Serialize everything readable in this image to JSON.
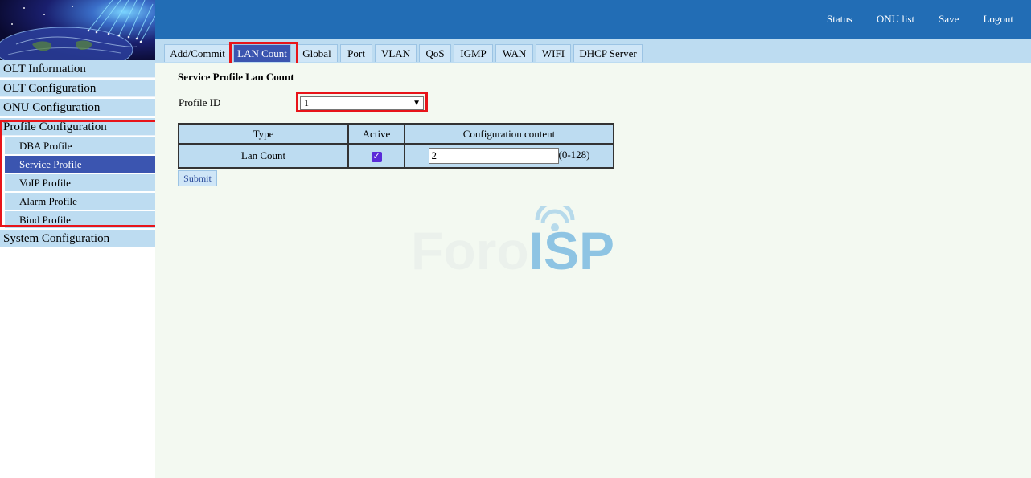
{
  "header": {
    "links": [
      "Status",
      "ONU list",
      "Save",
      "Logout"
    ]
  },
  "tabs": [
    "Add/Commit",
    "LAN Count",
    "Global",
    "Port",
    "VLAN",
    "QoS",
    "IGMP",
    "WAN",
    "WIFI",
    "DHCP Server"
  ],
  "active_tab": "LAN Count",
  "sidebar": {
    "items": [
      "OLT Information",
      "OLT Configuration",
      "ONU Configuration",
      "Profile Configuration"
    ],
    "sub_items": [
      "DBA Profile",
      "Service Profile",
      "VoIP Profile",
      "Alarm Profile",
      "Bind Profile"
    ],
    "active_sub": "Service Profile",
    "last_item": "System Configuration"
  },
  "main": {
    "title": "Service Profile Lan Count",
    "profile_label": "Profile ID",
    "profile_value": "1",
    "table": {
      "headers": [
        "Type",
        "Active",
        "Configuration content"
      ],
      "row": {
        "type": "Lan Count",
        "active": true,
        "value": "2",
        "range": "(0-128)"
      }
    },
    "submit_label": "Submit"
  },
  "watermark": {
    "text_part1": "Foro",
    "text_part2": "ISP"
  },
  "colors": {
    "header_blue": "#226db5",
    "active_blue": "#3b55b0",
    "highlight_red": "#e8141a",
    "light_blue": "#bddcf1",
    "content_bg": "#f3f9f1"
  }
}
